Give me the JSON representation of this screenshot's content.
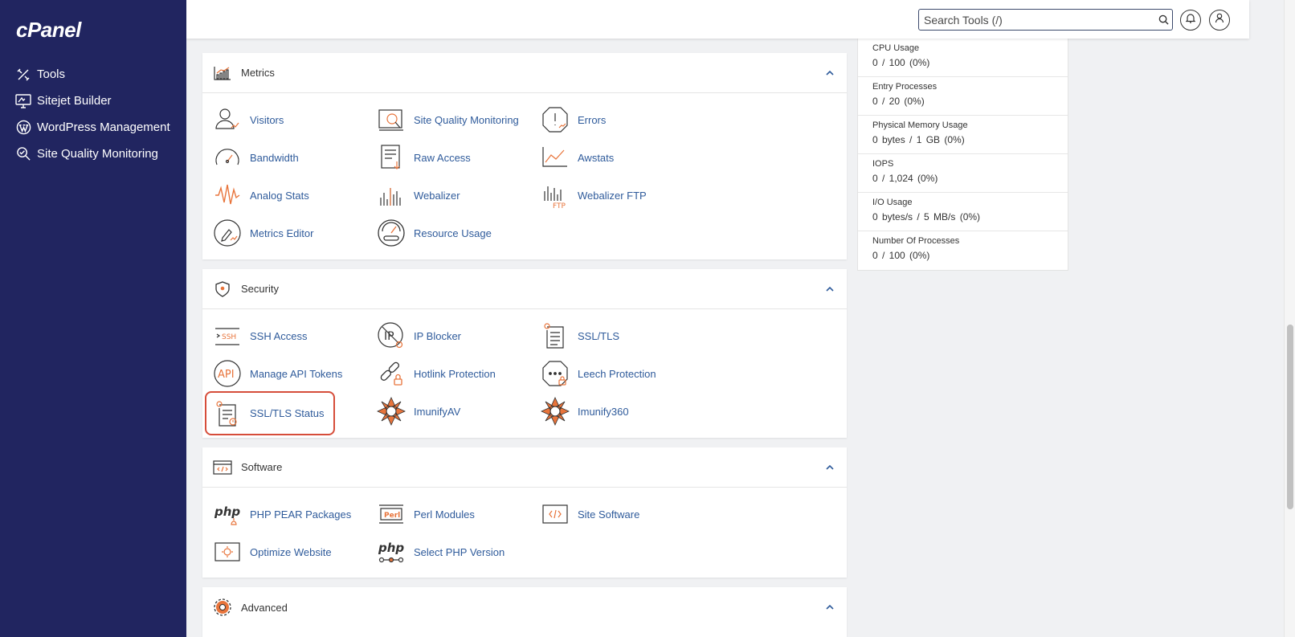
{
  "sidebar": {
    "logo": "cPanel",
    "items": [
      {
        "label": "Tools",
        "icon": "tools-icon"
      },
      {
        "label": "Sitejet Builder",
        "icon": "monitor-icon"
      },
      {
        "label": "WordPress Management",
        "icon": "wordpress-icon"
      },
      {
        "label": "Site Quality Monitoring",
        "icon": "site-quality-icon"
      }
    ]
  },
  "topbar": {
    "search_placeholder": "Search Tools (/)",
    "search_icon": "search-icon",
    "notifications_icon": "bell-icon",
    "user_icon": "user-icon"
  },
  "sections": {
    "metrics": {
      "title": "Metrics",
      "items": [
        "Visitors",
        "Site Quality Monitoring",
        "Errors",
        "Bandwidth",
        "Raw Access",
        "Awstats",
        "Analog Stats",
        "Webalizer",
        "Webalizer FTP",
        "Metrics Editor",
        "Resource Usage"
      ]
    },
    "security": {
      "title": "Security",
      "items": [
        "SSH Access",
        "IP Blocker",
        "SSL/TLS",
        "Manage API Tokens",
        "Hotlink Protection",
        "Leech Protection",
        "SSL/TLS Status",
        "ImunifyAV",
        "Imunify360"
      ]
    },
    "software": {
      "title": "Software",
      "items": [
        "PHP PEAR Packages",
        "Perl Modules",
        "Site Software",
        "Optimize Website",
        "Select PHP Version"
      ]
    },
    "advanced": {
      "title": "Advanced"
    }
  },
  "stats": [
    {
      "title": "CPU Usage",
      "value": "0 / 100   (0%)"
    },
    {
      "title": "Entry Processes",
      "value": "0 / 20   (0%)"
    },
    {
      "title": "Physical Memory Usage",
      "value": "0 bytes / 1 GB   (0%)"
    },
    {
      "title": "IOPS",
      "value": "0 / 1,024   (0%)"
    },
    {
      "title": "I/O Usage",
      "value": "0 bytes/s / 5 MB/s   (0%)"
    },
    {
      "title": "Number Of Processes",
      "value": "0 / 100   (0%)"
    }
  ],
  "colors": {
    "sidebar_bg": "#212560",
    "link": "#2f5b9b",
    "accent_orange": "#e8743b",
    "highlight": "#d64d3a"
  }
}
